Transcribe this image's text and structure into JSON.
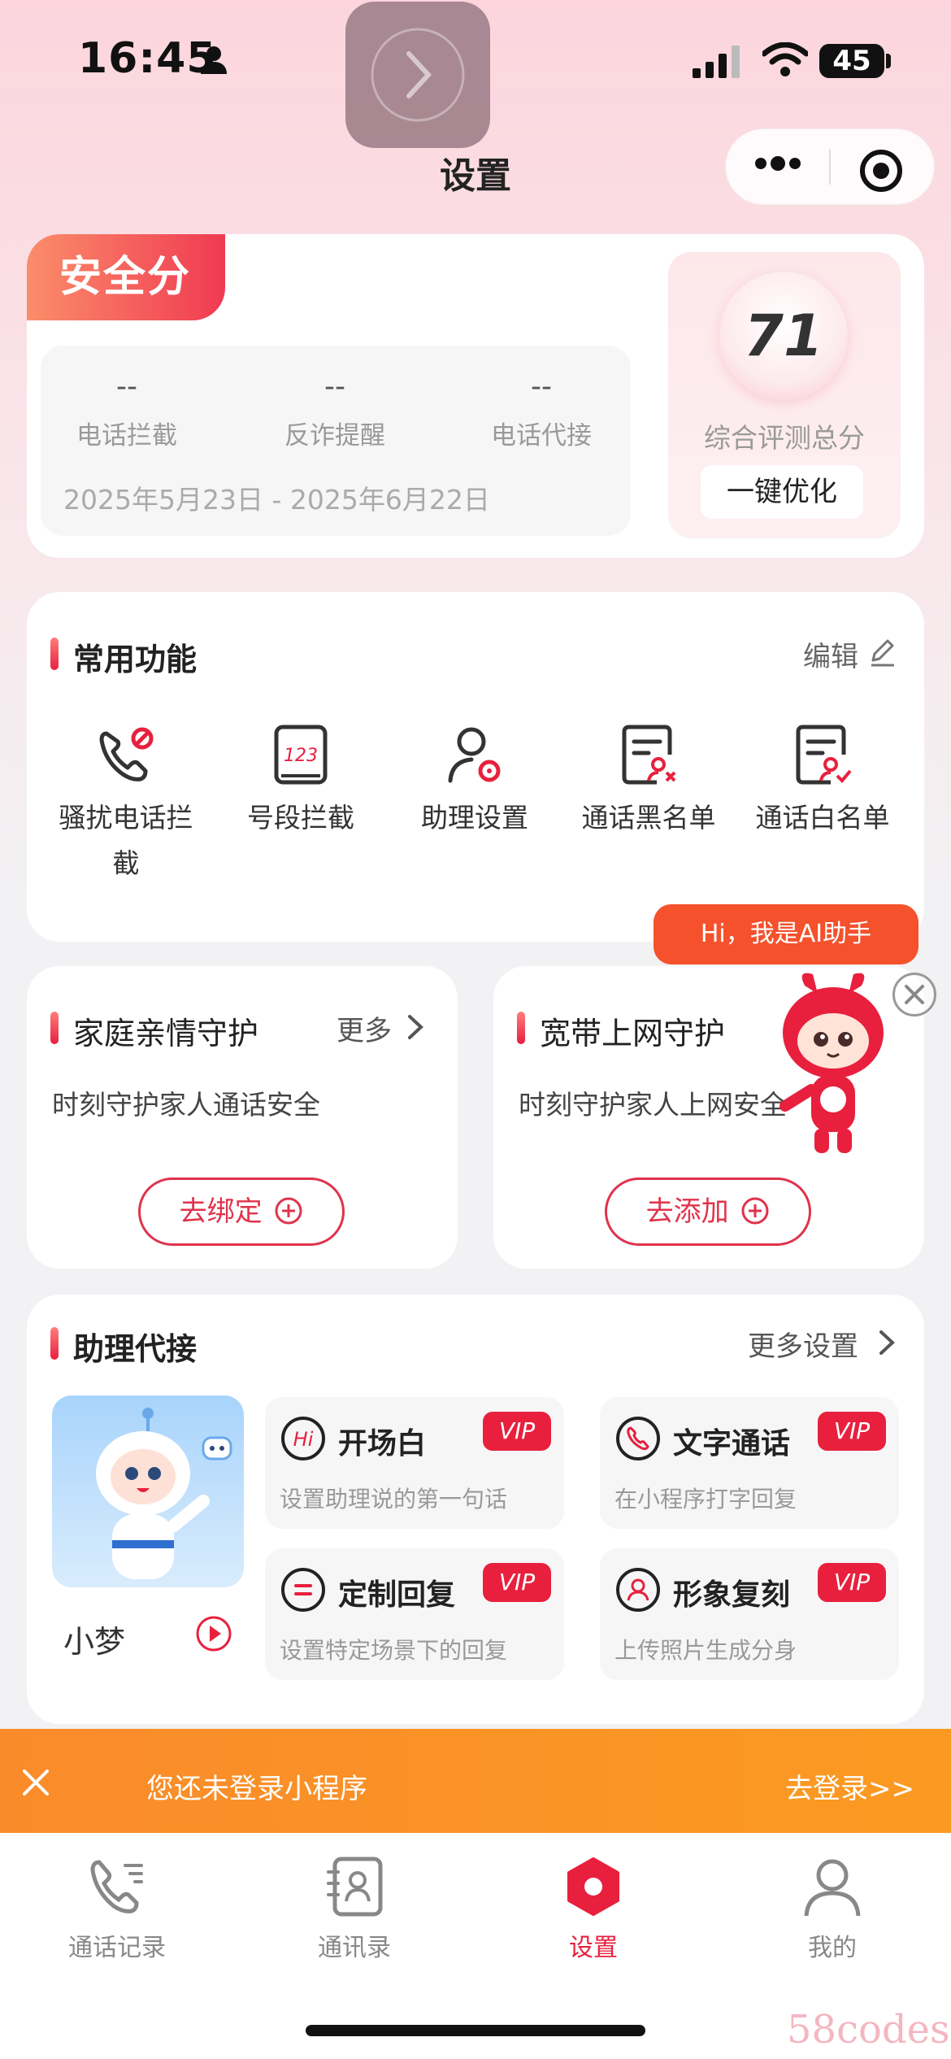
{
  "status_bar": {
    "time": "16:45",
    "battery": "45"
  },
  "header": {
    "title": "设置"
  },
  "safety": {
    "badge": "安全分",
    "stats": [
      {
        "value": "--",
        "label": "电话拦截"
      },
      {
        "value": "--",
        "label": "反诈提醒"
      },
      {
        "value": "--",
        "label": "电话代接"
      }
    ],
    "date_range": "2025年5月23日 - 2025年6月22日",
    "score": "71",
    "score_label": "综合评测总分",
    "optimize_label": "一键优化"
  },
  "common": {
    "title": "常用功能",
    "edit_label": "编辑",
    "items": [
      {
        "label": "骚扰电话拦截"
      },
      {
        "label": "号段拦截"
      },
      {
        "label": "助理设置"
      },
      {
        "label": "通话黑名单"
      },
      {
        "label": "通话白名单"
      }
    ]
  },
  "ai": {
    "bubble": "Hi，我是AI助手"
  },
  "family": {
    "title": "家庭亲情守护",
    "more": "更多",
    "desc": "时刻守护家人通话安全",
    "button": "去绑定"
  },
  "broadband": {
    "title": "宽带上网守护",
    "desc": "时刻守护家人上网安全",
    "button": "去添加"
  },
  "assist": {
    "title": "助理代接",
    "more": "更多设置",
    "robot_name": "小梦",
    "features": [
      {
        "title": "开场白",
        "desc": "设置助理说的第一句话",
        "badge": "VIP",
        "icon": "hi-icon"
      },
      {
        "title": "文字通话",
        "desc": "在小程序打字回复",
        "badge": "VIP",
        "icon": "phone-icon"
      },
      {
        "title": "定制回复",
        "desc": "设置特定场景下的回复",
        "badge": "VIP",
        "icon": "reply-icon"
      },
      {
        "title": "形象复刻",
        "desc": "上传照片生成分身",
        "badge": "VIP",
        "icon": "avatar-icon"
      }
    ]
  },
  "login_banner": {
    "text": "您还未登录小程序",
    "link": "去登录>>"
  },
  "tabs": [
    {
      "label": "通话记录",
      "active": false
    },
    {
      "label": "通讯录",
      "active": false
    },
    {
      "label": "设置",
      "active": true
    },
    {
      "label": "我的",
      "active": false
    }
  ],
  "watermark": "58codes",
  "colors": {
    "accent": "#e8203e",
    "banner": "#fa8b2a",
    "ai_bubble": "#f4512c"
  }
}
